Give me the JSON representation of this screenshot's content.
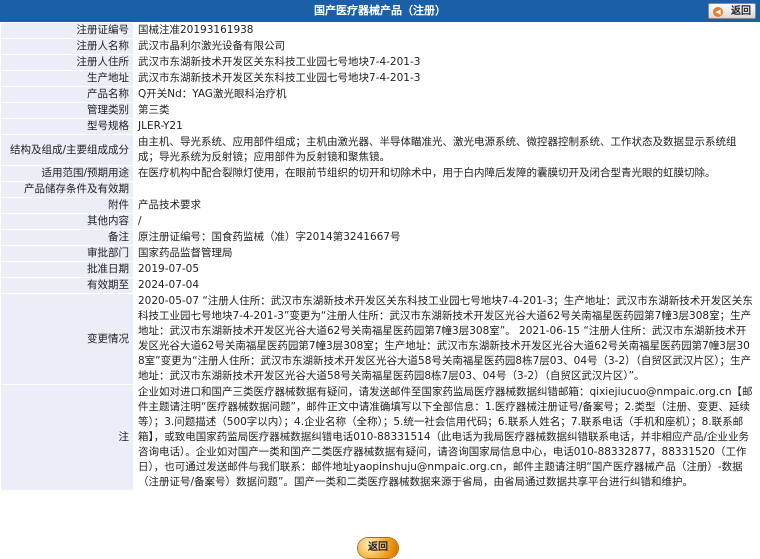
{
  "header": {
    "title": "国产医疗器械产品（注册）",
    "back_label": "返回"
  },
  "rows": [
    {
      "label": "注册证编号",
      "value": "国械注准20193161938"
    },
    {
      "label": "注册人名称",
      "value": "武汉市晶利尔激光设备有限公司"
    },
    {
      "label": "注册人住所",
      "value": "武汉市东湖新技术开发区关东科技工业园七号地块7-4-201-3"
    },
    {
      "label": "生产地址",
      "value": "武汉市东湖新技术开发区关东科技工业园七号地块7-4-201-3"
    },
    {
      "label": "产品名称",
      "value": "Q开关Nd：YAG激光眼科治疗机"
    },
    {
      "label": "管理类别",
      "value": "第三类"
    },
    {
      "label": "型号规格",
      "value": "JLER-Y21"
    },
    {
      "label": "结构及组成/主要组成成分",
      "value": "由主机、导光系统、应用部件组成；主机由激光器、半导体瞄准光、激光电源系统、微控器控制系统、工作状态及数据显示系统组成；导光系统为反射镜；应用部件为反射镜和聚焦镜。"
    },
    {
      "label": "适用范围/预期用途",
      "value": "在医疗机构中配合裂隙灯使用，在眼前节组织的切开和切除术中，用于白内障后发障的囊膜切开及闭合型青光眼的虹膜切除。"
    },
    {
      "label": "产品储存条件及有效期",
      "value": ""
    },
    {
      "label": "附件",
      "value": "产品技术要求"
    },
    {
      "label": "其他内容",
      "value": "/"
    },
    {
      "label": "备注",
      "value": "原注册证编号：国食药监械（准）字2014第3241667号"
    },
    {
      "label": "审批部门",
      "value": "国家药品监督管理局"
    },
    {
      "label": "批准日期",
      "value": "2019-07-05"
    },
    {
      "label": "有效期至",
      "value": "2024-07-04"
    },
    {
      "label": "变更情况",
      "value": "2020-05-07 “注册人住所：武汉市东湖新技术开发区关东科技工业园七号地块7-4-201-3；生产地址：武汉市东湖新技术开发区关东科技工业园七号地块7-4-201-3”变更为“注册人住所：武汉市东湖新技术开发区光谷大道62号关南福星医药园第7幢3层308室；生产地址：武汉市东湖新技术开发区光谷大道62号关南福星医药园第7幢3层308室”。 2021-06-15 “注册人住所：武汉市东湖新技术开发区光谷大道62号关南福星医药园第7幢3层308室；生产地址：武汉市东湖新技术开发区光谷大道62号关南福星医药园第7幢3层308室”变更为“注册人住所：武汉市东湖新技术开发区光谷大道58号关南福星医药园8栋7层03、04号（3-2）（自贸区武汉片区）；生产地址：武汉市东湖新技术开发区光谷大道58号关南福星医药园8栋7层03、04号（3-2）（自贸区武汉片区）”。"
    },
    {
      "label": "注",
      "value": "企业如对进口和国产三类医疗器械数据有疑问，请发送邮件至国家药监局医疗器械数据纠错邮箱：qixiejiucuo@nmpaic.org.cn【邮件主题请注明“医疗器械数据问题”，邮件正文中请准确填写以下全部信息：1.医疗器械注册证号/备案号；2.类型（注册、变更、延续等）；3.问题描述（500字以内）；4.企业名称（全称）；5.统一社会信用代码；6.联系人姓名；7.联系电话（手机和座机）；8.联系邮箱】，或致电国家药监局医疗器械数据纠错电话010-88331514（此电话为我局医疗器械数据纠错联系电话，并非相应产品/企业业务咨询电话）。企业如对国产一类和国产二类医疗器械数据有疑问，请咨询国家局信息中心，电话010-88332877，88331520（工作日），也可通过发送邮件与我们联系：邮件地址yaopinshuju@nmpaic.org.cn，邮件主题请注明“国产医疗器械产品（注册）-数据（注册证号/备案号）数据问题”。国产一类和二类医疗器械数据来源于省局，由省局通过数据共享平台进行纠错和维护。"
    }
  ]
}
